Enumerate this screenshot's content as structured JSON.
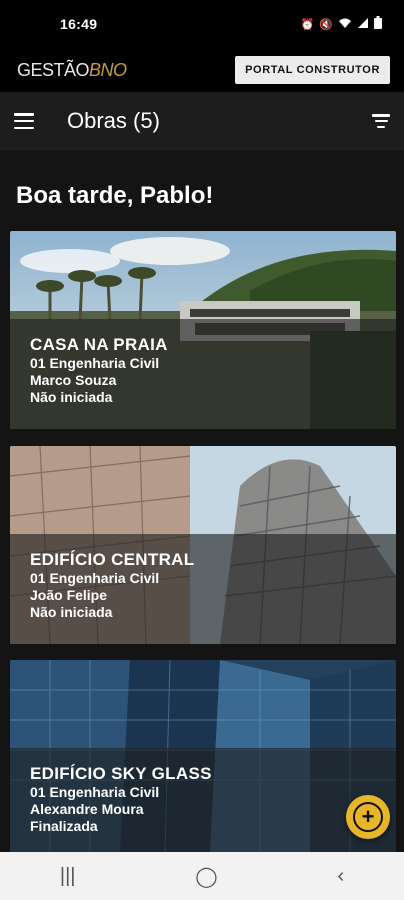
{
  "status_bar": {
    "time": "16:49"
  },
  "brand": {
    "logo_part1": "GESTÃO",
    "logo_part2": "BNO",
    "portal_button": "PORTAL CONSTRUTOR"
  },
  "app_bar": {
    "title": "Obras (5)"
  },
  "greeting": "Boa tarde, Pablo!",
  "obras": [
    {
      "title": "CASA NA PRAIA",
      "company": "01 Engenharia Civil",
      "person": "Marco Souza",
      "status": "Não iniciada"
    },
    {
      "title": "EDIFÍCIO CENTRAL",
      "company": "01 Engenharia Civil",
      "person": "João Felipe",
      "status": "Não iniciada"
    },
    {
      "title": "EDIFÍCIO SKY GLASS",
      "company": "01 Engenharia Civil",
      "person": "Alexandre Moura",
      "status": "Finalizada"
    }
  ],
  "fab": {
    "icon": "plus-circle-icon"
  },
  "colors": {
    "accent": "#e6b52a",
    "logo_gold": "#c79b3b",
    "background": "#141414"
  }
}
